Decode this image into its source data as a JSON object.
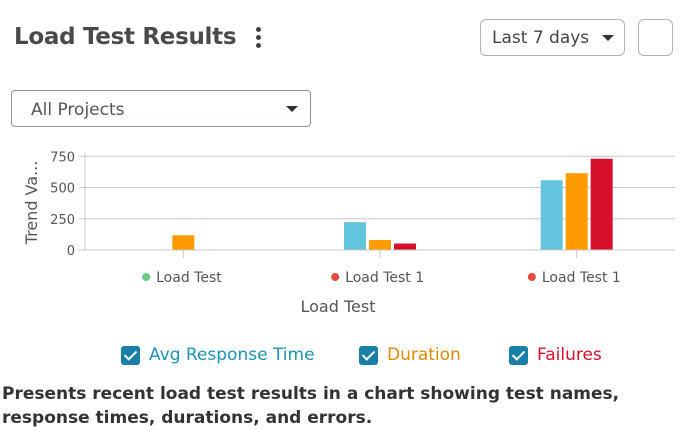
{
  "header": {
    "title": "Load Test Results",
    "range_label": "Last 7 days"
  },
  "filter": {
    "project_label": "All Projects"
  },
  "chart_data": {
    "type": "bar",
    "categories": [
      "Load Test",
      "Load Test 1",
      "Load Test 1"
    ],
    "category_dot_colors": [
      "#66cc88",
      "#e54b3c",
      "#e54b3c"
    ],
    "series": [
      {
        "name": "Avg Response Time",
        "color": "#62c4dd",
        "values": [
          0,
          222,
          558
        ]
      },
      {
        "name": "Duration",
        "color": "#ff9a00",
        "values": [
          118,
          80,
          615
        ]
      },
      {
        "name": "Failures",
        "color": "#d6102b",
        "values": [
          0,
          52,
          730
        ]
      }
    ],
    "xlabel": "Load Test",
    "ylabel": "Trend Va...",
    "yticks": [
      0,
      250,
      500,
      750
    ],
    "ylim": [
      0,
      760
    ],
    "grid": true
  },
  "legend": {
    "items": [
      {
        "label": "Avg Response Time",
        "color": "#1a94b8",
        "checked": true
      },
      {
        "label": "Duration",
        "color": "#e38a00",
        "checked": true
      },
      {
        "label": "Failures",
        "color": "#d6102b",
        "checked": true
      }
    ]
  },
  "description": "Presents recent load test results in a chart showing test names, response times, durations, and errors."
}
